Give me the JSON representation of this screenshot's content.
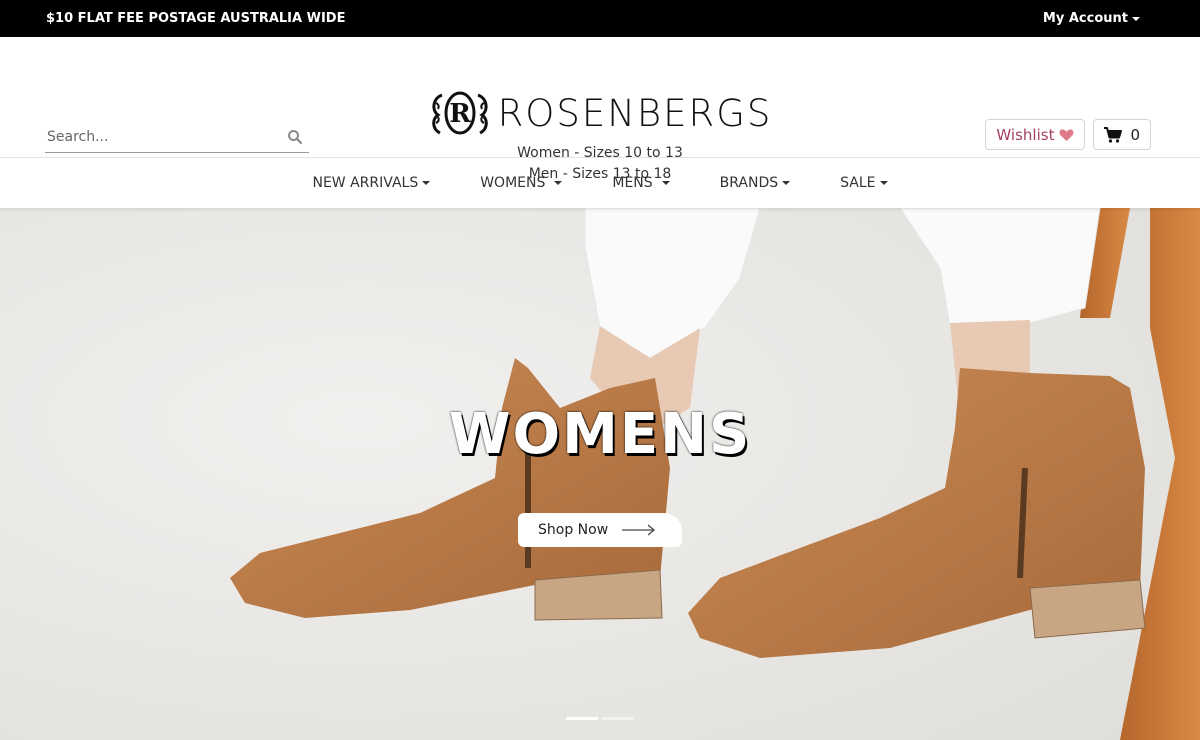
{
  "topbar": {
    "promo": "$10 FLAT FEE POSTAGE AUSTRALIA WIDE",
    "account_label": "My Account"
  },
  "header": {
    "search_placeholder": "Search...",
    "brand_name": "ROSENBERGS",
    "logo_letter": "R",
    "sizes_women": "Women - Sizes 10 to 13",
    "sizes_men": "Men - Sizes 13 to 18",
    "wishlist_label": "Wishlist",
    "cart_count": "0",
    "colors": {
      "wishlist_text": "#a4425d",
      "heart": "#e07b8a"
    }
  },
  "nav": {
    "items": [
      {
        "label": "NEW ARRIVALS"
      },
      {
        "label": "WOMENS"
      },
      {
        "label": "MENS"
      },
      {
        "label": "BRANDS"
      },
      {
        "label": "SALE"
      }
    ]
  },
  "hero": {
    "title": "WOMENS",
    "cta_label": "Shop Now",
    "slide_count": 2,
    "active_slide": 1,
    "colors": {
      "boot": "#b87a48",
      "background": "#ecebe8"
    }
  }
}
